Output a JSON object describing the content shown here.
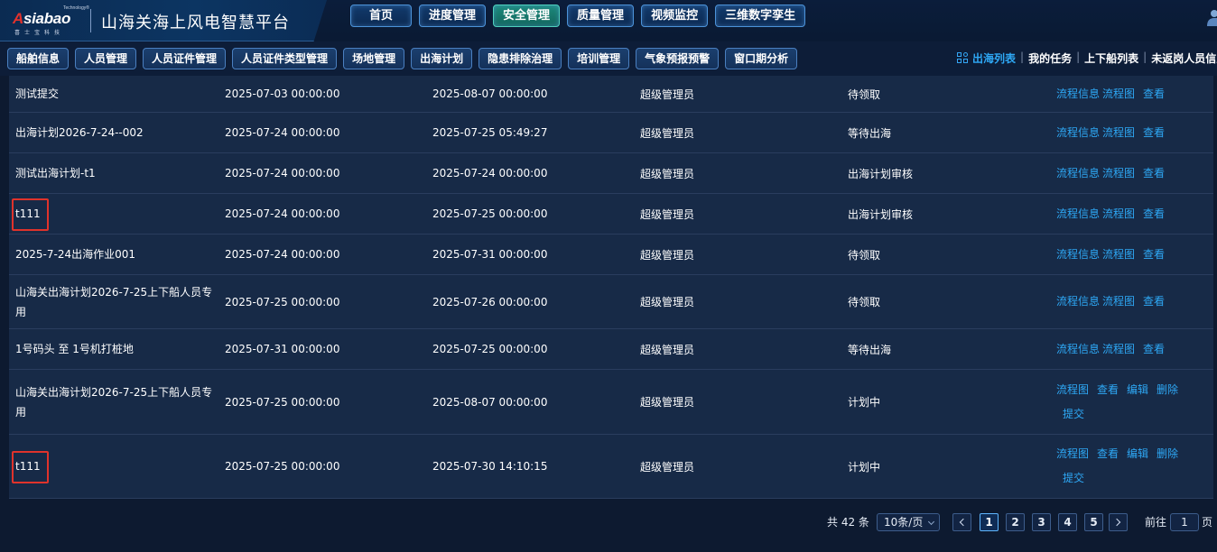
{
  "brand": {
    "logo_text_a": "A",
    "logo_text_rest": "siabao",
    "logo_tm": "Technology®",
    "logo_sub": "喜士宝科技",
    "title": "山海关海上风电智慧平台"
  },
  "top_nav": [
    {
      "label": "首页",
      "active": false
    },
    {
      "label": "进度管理",
      "active": false
    },
    {
      "label": "安全管理",
      "active": true
    },
    {
      "label": "质量管理",
      "active": false
    },
    {
      "label": "视频监控",
      "active": false
    },
    {
      "label": "三维数字孪生",
      "active": false
    }
  ],
  "sub_nav": [
    "船舶信息",
    "人员管理",
    "人员证件管理",
    "人员证件类型管理",
    "场地管理",
    "出海计划",
    "隐患排除治理",
    "培训管理",
    "气象预报预警",
    "窗口期分析"
  ],
  "quick_links": {
    "active": "出海列表",
    "items": [
      "我的任务",
      "上下船列表",
      "未返岗人员信息"
    ]
  },
  "table": {
    "rows": [
      {
        "name": "测试提交",
        "start": "2025-07-03 00:00:00",
        "end": "2025-08-07 00:00:00",
        "creator": "超级管理员",
        "status": "待领取",
        "ops": [
          "流程信息",
          "流程图",
          "查看"
        ]
      },
      {
        "name": "出海计划2026-7-24--002",
        "start": "2025-07-24 00:00:00",
        "end": "2025-07-25 05:49:27",
        "creator": "超级管理员",
        "status": "等待出海",
        "ops": [
          "流程信息",
          "流程图",
          "查看"
        ]
      },
      {
        "name": "测试出海计划-t1",
        "start": "2025-07-24 00:00:00",
        "end": "2025-07-24 00:00:00",
        "creator": "超级管理员",
        "status": "出海计划审核",
        "ops": [
          "流程信息",
          "流程图",
          "查看"
        ]
      },
      {
        "name": "t111",
        "start": "2025-07-24 00:00:00",
        "end": "2025-07-25 00:00:00",
        "creator": "超级管理员",
        "status": "出海计划审核",
        "ops": [
          "流程信息",
          "流程图",
          "查看"
        ]
      },
      {
        "name": "2025-7-24出海作业001",
        "start": "2025-07-24 00:00:00",
        "end": "2025-07-31 00:00:00",
        "creator": "超级管理员",
        "status": "待领取",
        "ops": [
          "流程信息",
          "流程图",
          "查看"
        ]
      },
      {
        "name": "山海关出海计划2026-7-25上下船人员专用",
        "start": "2025-07-25 00:00:00",
        "end": "2025-07-26 00:00:00",
        "creator": "超级管理员",
        "status": "待领取",
        "ops": [
          "流程信息",
          "流程图",
          "查看"
        ]
      },
      {
        "name": "1号码头 至 1号机打桩地",
        "start": "2025-07-31 00:00:00",
        "end": "2025-07-25 00:00:00",
        "creator": "超级管理员",
        "status": "等待出海",
        "ops": [
          "流程信息",
          "流程图",
          "查看"
        ]
      },
      {
        "name": "山海关出海计划2026-7-25上下船人员专用",
        "start": "2025-07-25 00:00:00",
        "end": "2025-08-07 00:00:00",
        "creator": "超级管理员",
        "status": "计划中",
        "ops": [
          "流程图",
          "查看",
          "编辑",
          "删除",
          "提交"
        ]
      },
      {
        "name": "t111",
        "start": "2025-07-25 00:00:00",
        "end": "2025-07-30 14:10:15",
        "creator": "超级管理员",
        "status": "计划中",
        "ops": [
          "流程图",
          "查看",
          "编辑",
          "删除",
          "提交"
        ]
      }
    ]
  },
  "pagination": {
    "total_text": "共 42 条",
    "page_size": "10条/页",
    "pages": [
      "1",
      "2",
      "3",
      "4",
      "5"
    ],
    "current": "1",
    "goto_label": "前往",
    "goto_value": "1",
    "goto_unit": "页"
  },
  "colors": {
    "link": "#2ea8f5",
    "highlight_box": "#e0332b",
    "active_nav": "#1c8a7c"
  }
}
